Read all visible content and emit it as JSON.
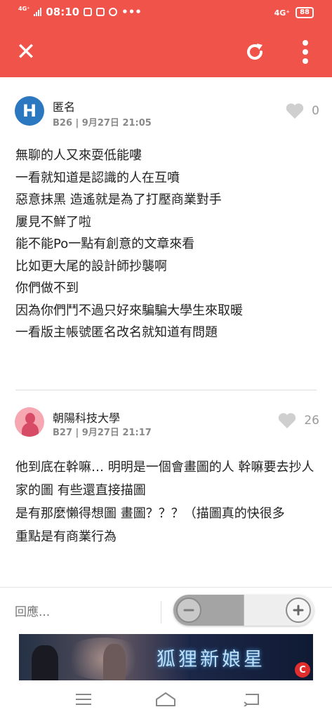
{
  "status_bar": {
    "network": "4G⁺",
    "time": "08:10",
    "right_network": "4G⁺",
    "battery": "88"
  },
  "toolbar": {
    "close_icon": "close-icon",
    "refresh_icon": "refresh-icon",
    "more_icon": "more-vertical-icon"
  },
  "posts": [
    {
      "avatar_letter": "H",
      "avatar_color": "#2b77c0",
      "author": "匿名",
      "meta": "B26 | 9月27日 21:05",
      "likes": "0",
      "lines": [
        "無聊的人又來耍低能嘍",
        "一看就知道是認識的人在互噴",
        "惡意抹黑 造遙就是為了打壓商業對手",
        "屢見不鮮了啦",
        "能不能Po一點有創意的文章來看",
        "比如更大尾的設計師抄襲啊",
        "你們做不到",
        "因為你們鬥不過只好來騙騙大學生來取暖",
        "一看版主帳號匿名改名就知道有問題"
      ]
    },
    {
      "avatar_color": "#f7a7b1",
      "author": "朝陽科技大學",
      "meta": "B27 | 9月27日 21:17",
      "likes": "26",
      "lines": [
        "他到底在幹嘛… 明明是一個會畫圖的人 幹嘛要去抄人家的圖 有些還直接描圖",
        "是有那麼懶得想圖 畫圖？？？（描圖真的快很多",
        "重點是有商業行為"
      ]
    }
  ],
  "reply": {
    "placeholder": "回應..."
  },
  "ad": {
    "title": "狐狸新娘星",
    "badge": "C"
  },
  "colors": {
    "accent": "#f0534a",
    "like_gray": "#cfcfcf"
  }
}
